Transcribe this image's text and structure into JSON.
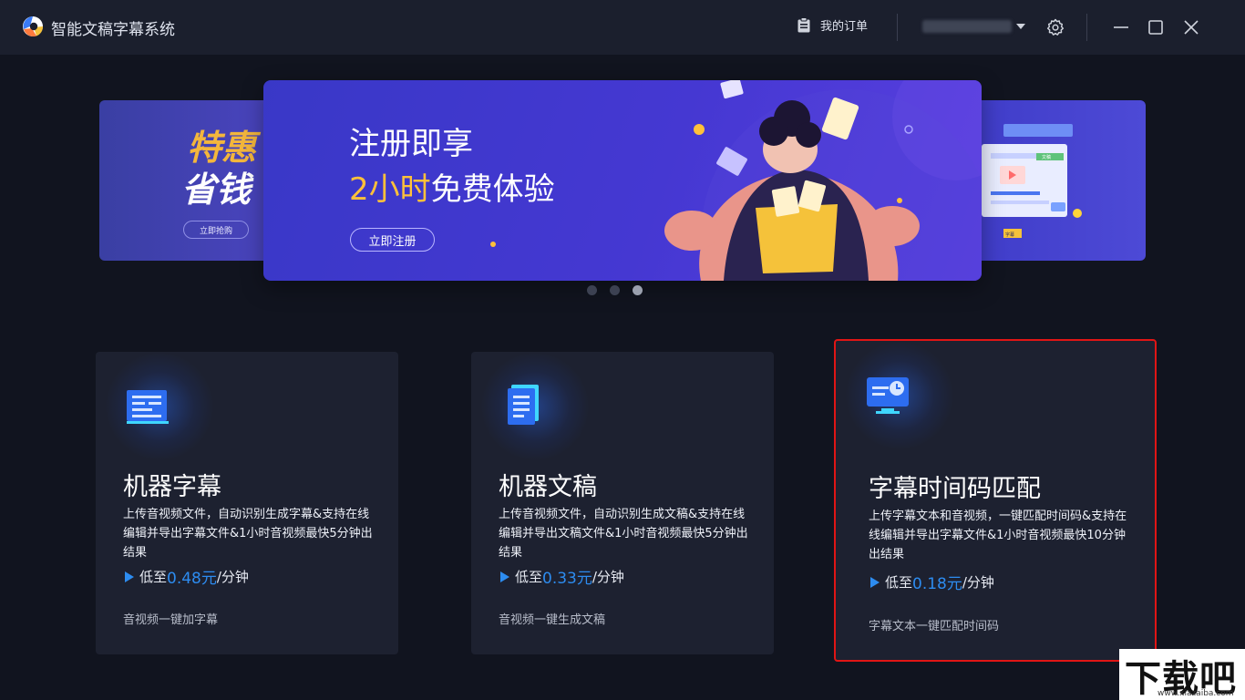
{
  "app": {
    "title": "智能文稿字幕系统"
  },
  "header": {
    "orders_label": "我的订单"
  },
  "carousel": {
    "left_slide": {
      "line1": "特惠",
      "line2": "省钱",
      "button": "立即抢购"
    },
    "main_slide": {
      "line1": "注册即享",
      "line2_highlight": "2小时",
      "line2_rest": "免费体验",
      "button": "立即注册"
    },
    "right_slide": {
      "tag": "文稿",
      "tag2": "字幕"
    },
    "dots": 3,
    "active_dot": 3
  },
  "cards": [
    {
      "title": "机器字幕",
      "desc": "上传音视频文件，自动识别生成字幕&支持在线编辑并导出字幕文件&1小时音视频最快5分钟出结果",
      "price_prefix": "低至",
      "price_value": "0.48元",
      "price_suffix": "/分钟",
      "sub": "音视频一键加字幕"
    },
    {
      "title": "机器文稿",
      "desc": "上传音视频文件，自动识别生成文稿&支持在线编辑并导出文稿文件&1小时音视频最快5分钟出结果",
      "price_prefix": "低至",
      "price_value": "0.33元",
      "price_suffix": "/分钟",
      "sub": "音视频一键生成文稿"
    },
    {
      "title": "字幕时间码匹配",
      "desc": "上传字幕文本和音视频，一键匹配时间码&支持在线编辑并导出字幕文件&1小时音视频最快10分钟出结果",
      "price_prefix": "低至",
      "price_value": "0.18元",
      "price_suffix": "/分钟",
      "sub": "字幕文本一键匹配时间码"
    }
  ],
  "watermark": {
    "text": "下载吧",
    "url": "www.xiazaiba.com"
  },
  "colors": {
    "accent": "#2d8cf0",
    "highlight": "#ffc13a",
    "selection": "#e01515"
  }
}
